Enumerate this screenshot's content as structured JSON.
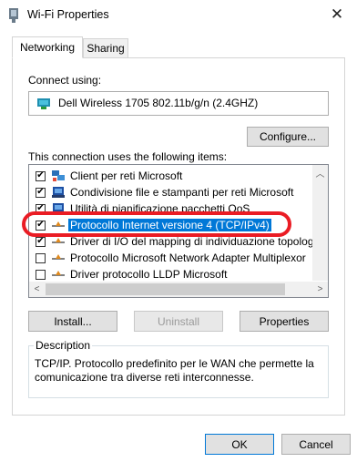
{
  "window": {
    "title": "Wi-Fi Properties"
  },
  "tabs": [
    {
      "label": "Networking"
    },
    {
      "label": "Sharing"
    }
  ],
  "connect": {
    "label": "Connect using:",
    "adapter": "Dell Wireless 1705 802.11b/g/n (2.4GHZ)",
    "configure_label": "Configure..."
  },
  "items": {
    "label": "This connection uses the following items:",
    "rows": [
      {
        "label": "Client per reti Microsoft",
        "checked": true
      },
      {
        "label": "Condivisione file e stampanti per reti Microsoft",
        "checked": true
      },
      {
        "label": "Utilità di pianificazione pacchetti QoS",
        "checked": true
      },
      {
        "label": "Protocollo Internet versione 4 (TCP/IPv4)",
        "checked": true,
        "selected": true
      },
      {
        "label": "Driver di I/O del mapping di individuazione topologia liv",
        "checked": true
      },
      {
        "label": "Protocollo Microsoft Network Adapter Multiplexor",
        "checked": false
      },
      {
        "label": "Driver protocollo LLDP Microsoft",
        "checked": false
      }
    ]
  },
  "buttons": {
    "install": "Install...",
    "uninstall": "Uninstall",
    "properties": "Properties",
    "ok": "OK",
    "cancel": "Cancel"
  },
  "description": {
    "legend": "Description",
    "text": "TCP/IP. Protocollo predefinito per le WAN che permette la comunicazione tra diverse reti interconnesse."
  },
  "annotation_color": "#ea1c24",
  "accent_color": "#0078d7"
}
